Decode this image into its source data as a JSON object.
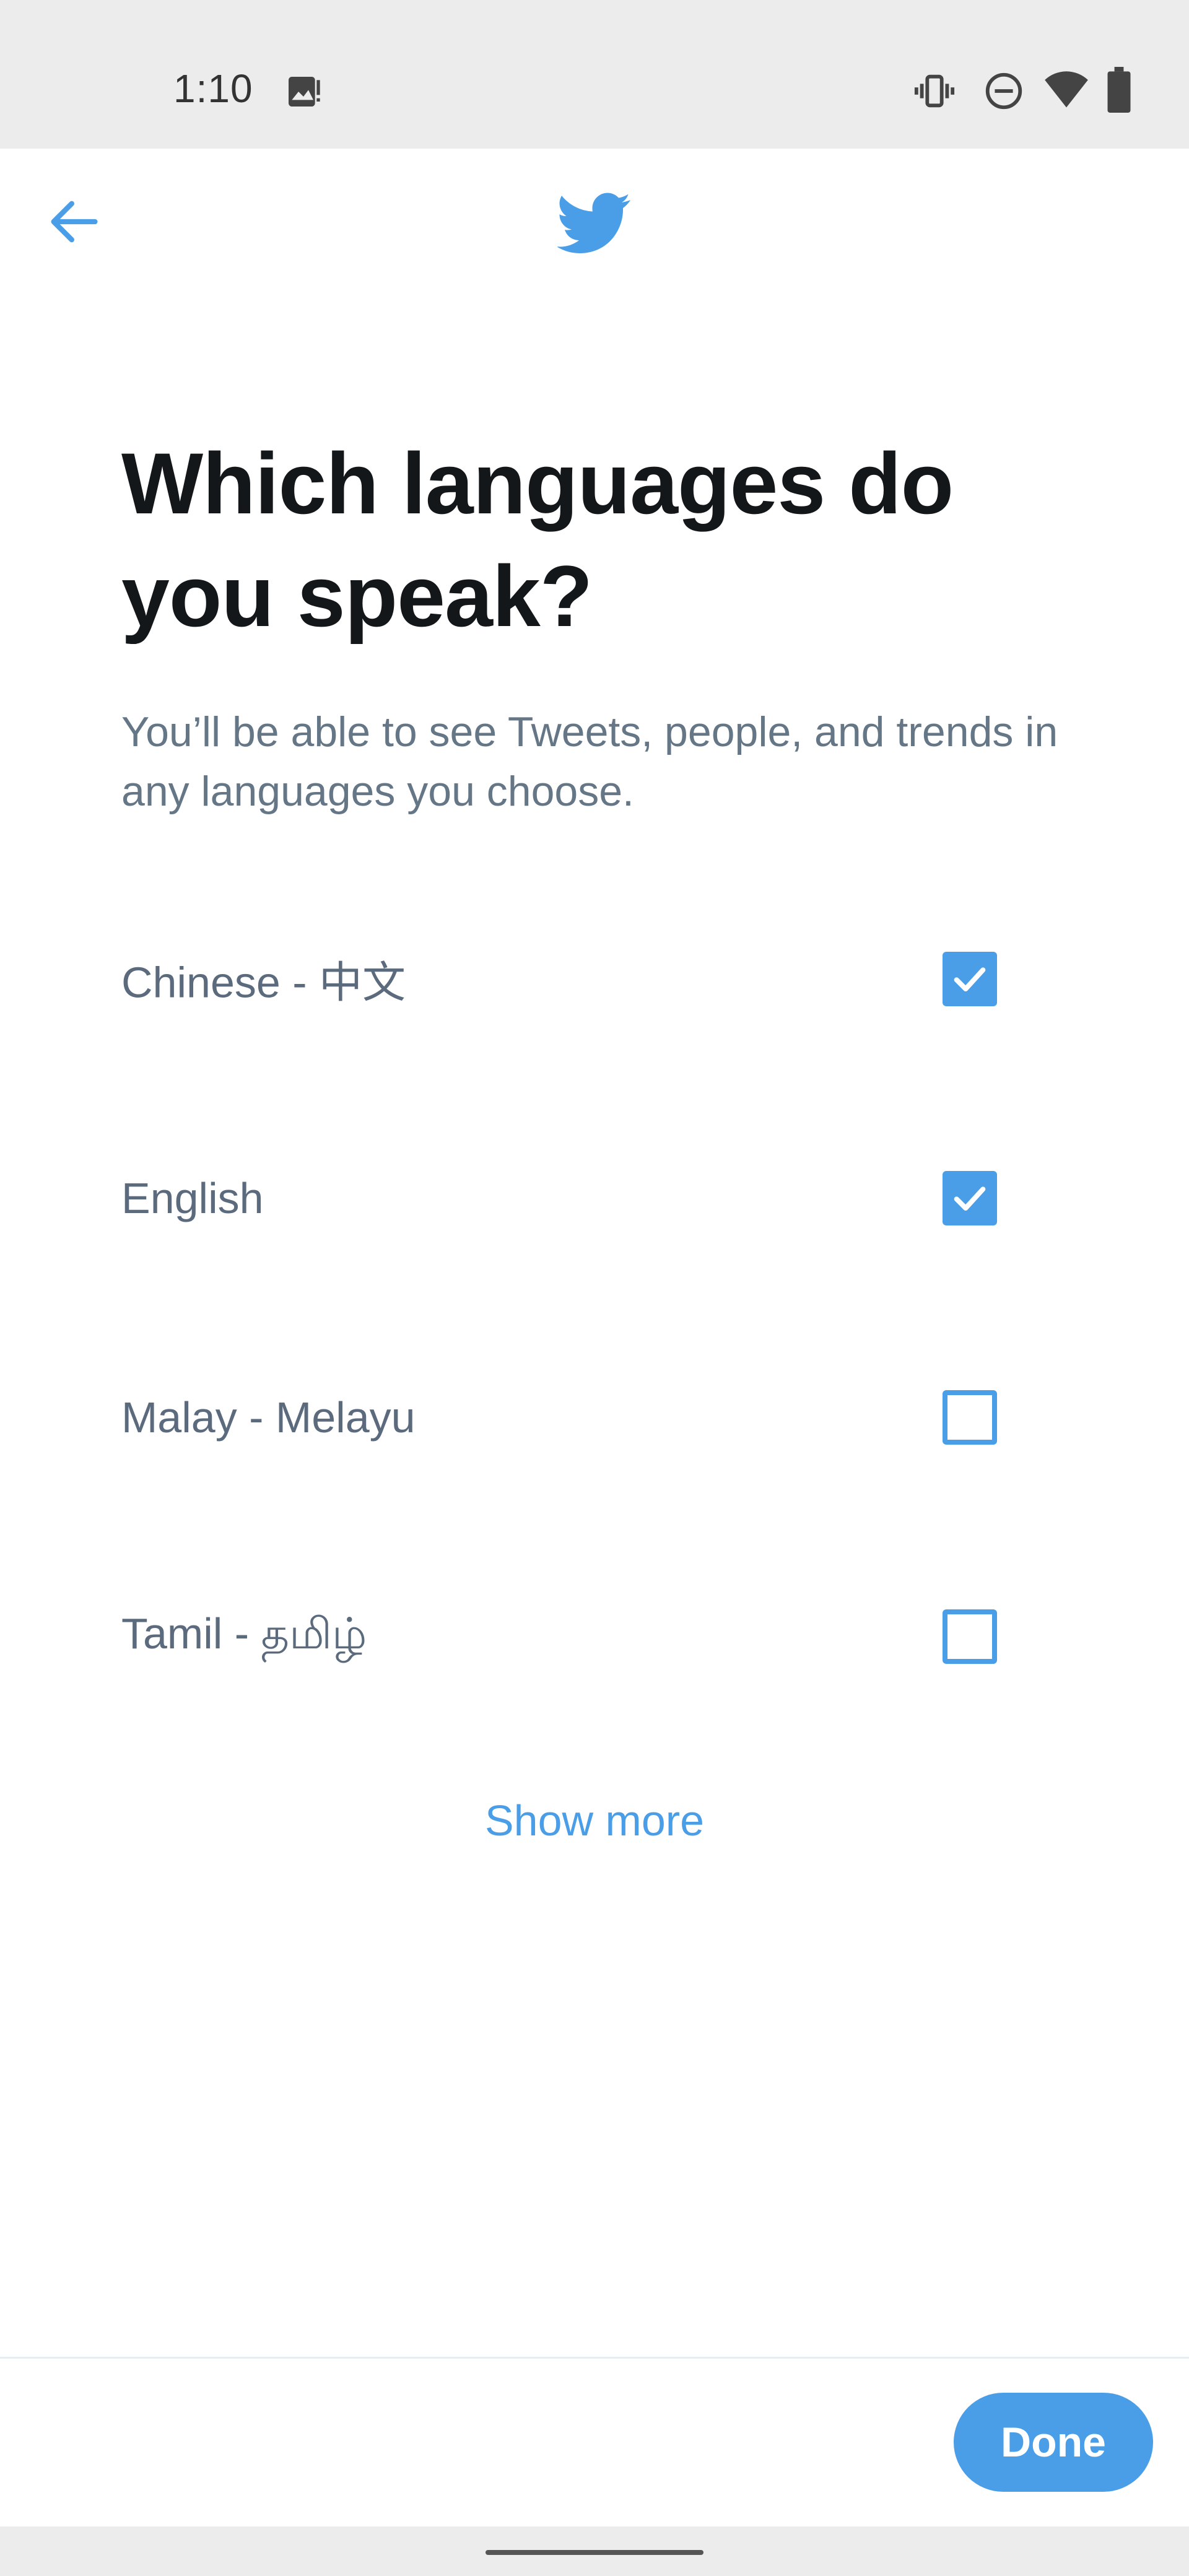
{
  "status_bar": {
    "time": "1:10",
    "icons": [
      "image-notification-icon",
      "vibrate-icon",
      "do-not-disturb-icon",
      "wifi-icon",
      "battery-icon"
    ]
  },
  "top_bar": {
    "back_icon": "arrow-left-icon",
    "logo_icon": "twitter-bird-icon"
  },
  "header": {
    "title": "Which languages do you speak?",
    "subtitle": "You’ll be able to see Tweets, people, and trends in any languages you choose."
  },
  "languages": [
    {
      "label": "Chinese - 中文",
      "checked": true
    },
    {
      "label": "English",
      "checked": true
    },
    {
      "label": "Malay - Melayu",
      "checked": false
    },
    {
      "label": "Tamil - தமிழ்",
      "checked": false
    }
  ],
  "show_more_label": "Show more",
  "footer": {
    "done_label": "Done"
  },
  "colors": {
    "accent": "#4a9ee8",
    "title": "#14171a",
    "text_secondary": "#657786",
    "status_bar_bg": "#ececec"
  }
}
